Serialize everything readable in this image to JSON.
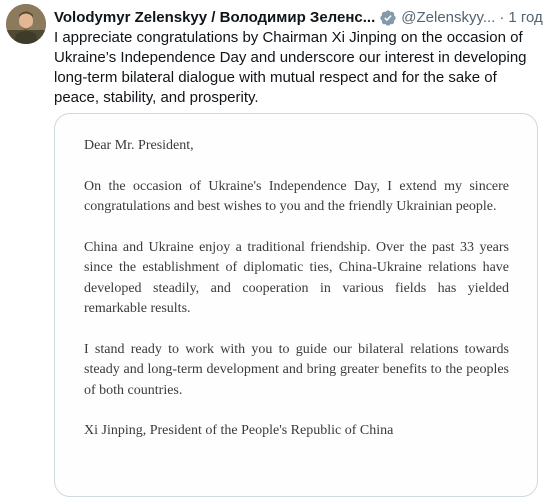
{
  "post": {
    "author_name": "Volodymyr Zelenskyy / Володимир Зеленс...",
    "handle": "@Zelenskyy...",
    "separator": "·",
    "timestamp": "1 год",
    "text": "I appreciate congratulations by Chairman Xi Jinping on the occasion of Ukraine’s Independence Day and underscore our interest in developing long-term bilateral dialogue with mutual respect and for the sake of peace, stability, and prosperity."
  },
  "letter": {
    "greeting": "Dear Mr. President,",
    "paragraph_1": "On the occasion of Ukraine's Independence Day, I extend my sincere congratulations and best wishes to you and the friendly Ukrainian people.",
    "paragraph_2": "China and Ukraine enjoy a traditional friendship. Over the past 33 years since the establishment of diplomatic ties, China-Ukraine relations have developed steadily, and cooperation in various fields has yielded remarkable results.",
    "paragraph_3": "I stand ready to work with you to guide our bilateral relations towards steady and long-term development and bring greater benefits to the peoples of both countries.",
    "signature": "Xi Jinping, President of the People's Republic of China"
  },
  "icons": {
    "verified": "verified-badge-icon",
    "avatar": "user-avatar"
  },
  "colors": {
    "text_primary": "#0f1419",
    "text_secondary": "#536471",
    "card_border": "#cfd9de",
    "verified_badge": "#829aab"
  }
}
